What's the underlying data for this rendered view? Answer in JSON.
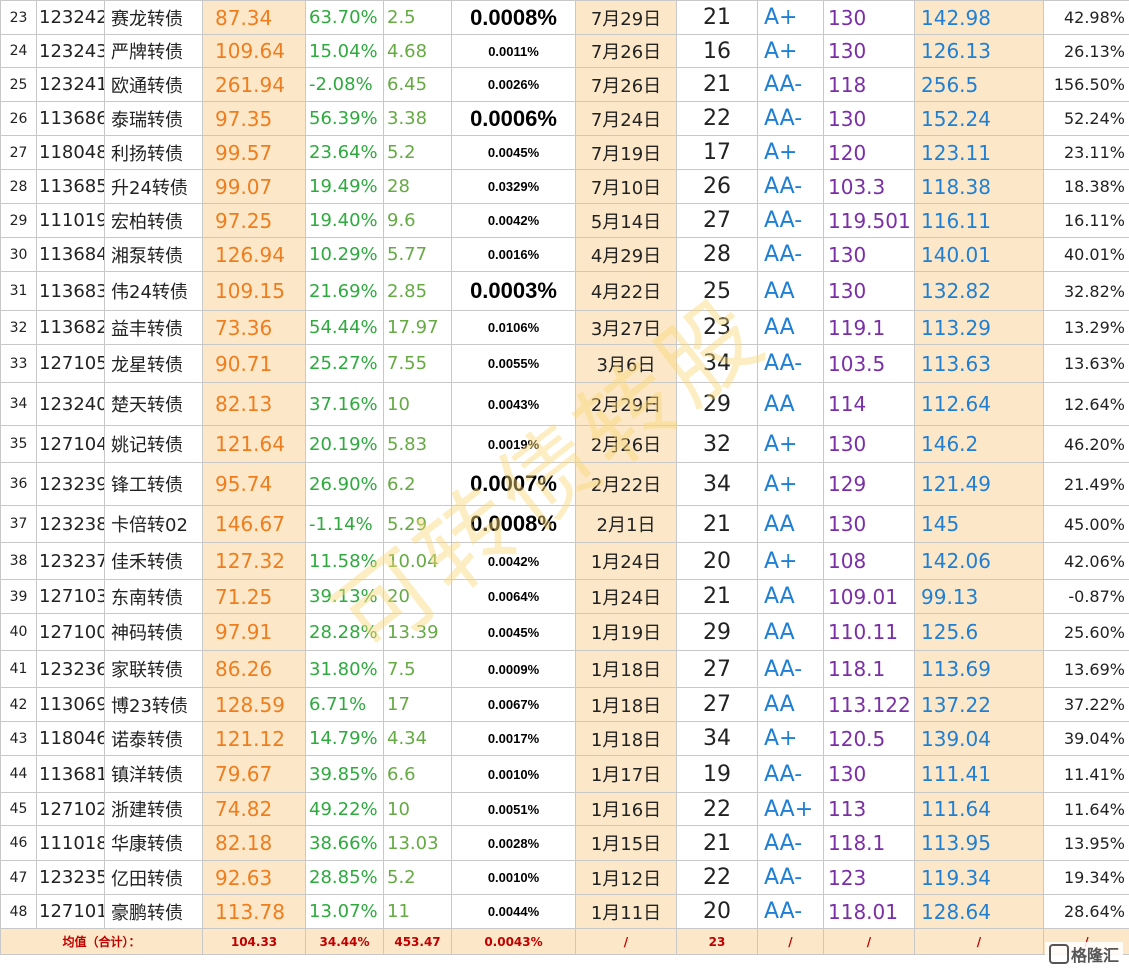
{
  "rows": [
    {
      "idx": "23",
      "code": "123242",
      "name": "赛龙转债",
      "price": "87.34",
      "pct": "63.70%",
      "ratio": "2.5",
      "rate": "0.0008%",
      "rate_big": true,
      "date": "7月29日",
      "num": "21",
      "grade": "A+",
      "first": "130",
      "last": "142.98",
      "gain": "42.98%"
    },
    {
      "idx": "24",
      "code": "123243",
      "name": "严牌转债",
      "price": "109.64",
      "pct": "15.04%",
      "ratio": "4.68",
      "rate": "0.0011%",
      "rate_big": false,
      "date": "7月26日",
      "num": "16",
      "grade": "A+",
      "first": "130",
      "last": "126.13",
      "gain": "26.13%"
    },
    {
      "idx": "25",
      "code": "123241",
      "name": "欧通转债",
      "price": "261.94",
      "pct": "-2.08%",
      "ratio": "6.45",
      "rate": "0.0026%",
      "rate_big": false,
      "date": "7月26日",
      "num": "21",
      "grade": "AA-",
      "first": "118",
      "last": "256.5",
      "gain": "156.50%"
    },
    {
      "idx": "26",
      "code": "113686",
      "name": "泰瑞转债",
      "price": "97.35",
      "pct": "56.39%",
      "ratio": "3.38",
      "rate": "0.0006%",
      "rate_big": true,
      "date": "7月24日",
      "num": "22",
      "grade": "AA-",
      "first": "130",
      "last": "152.24",
      "gain": "52.24%"
    },
    {
      "idx": "27",
      "code": "118048",
      "name": "利扬转债",
      "price": "99.57",
      "pct": "23.64%",
      "ratio": "5.2",
      "rate": "0.0045%",
      "rate_big": false,
      "date": "7月19日",
      "num": "17",
      "grade": "A+",
      "first": "120",
      "last": "123.11",
      "gain": "23.11%"
    },
    {
      "idx": "28",
      "code": "113685",
      "name": "升24转债",
      "price": "99.07",
      "pct": "19.49%",
      "ratio": "28",
      "rate": "0.0329%",
      "rate_big": false,
      "date": "7月10日",
      "num": "26",
      "grade": "AA-",
      "first": "103.3",
      "last": "118.38",
      "gain": "18.38%"
    },
    {
      "idx": "29",
      "code": "111019",
      "name": "宏柏转债",
      "price": "97.25",
      "pct": "19.40%",
      "ratio": "9.6",
      "rate": "0.0042%",
      "rate_big": false,
      "date": "5月14日",
      "num": "27",
      "grade": "AA-",
      "first": "119.501",
      "last": "116.11",
      "gain": "16.11%"
    },
    {
      "idx": "30",
      "code": "113684",
      "name": "湘泵转债",
      "price": "126.94",
      "pct": "10.29%",
      "ratio": "5.77",
      "rate": "0.0016%",
      "rate_big": false,
      "date": "4月29日",
      "num": "28",
      "grade": "AA-",
      "first": "130",
      "last": "140.01",
      "gain": "40.01%"
    },
    {
      "idx": "31",
      "code": "113683",
      "name": "伟24转债",
      "price": "109.15",
      "pct": "21.69%",
      "ratio": "2.85",
      "rate": "0.0003%",
      "rate_big": true,
      "date": "4月22日",
      "num": "25",
      "grade": "AA",
      "first": "130",
      "last": "132.82",
      "gain": "32.82%"
    },
    {
      "idx": "32",
      "code": "113682",
      "name": "益丰转债",
      "price": "73.36",
      "pct": "54.44%",
      "ratio": "17.97",
      "rate": "0.0106%",
      "rate_big": false,
      "date": "3月27日",
      "num": "23",
      "grade": "AA",
      "first": "119.1",
      "last": "113.29",
      "gain": "13.29%"
    },
    {
      "idx": "33",
      "code": "127105",
      "name": "龙星转债",
      "price": "90.71",
      "pct": "25.27%",
      "ratio": "7.55",
      "rate": "0.0055%",
      "rate_big": false,
      "date": "3月6日",
      "num": "34",
      "grade": "AA-",
      "first": "103.5",
      "last": "113.63",
      "gain": "13.63%"
    },
    {
      "idx": "34",
      "code": "123240",
      "name": "楚天转债",
      "price": "82.13",
      "pct": "37.16%",
      "ratio": "10",
      "rate": "0.0043%",
      "rate_big": false,
      "date": "2月29日",
      "num": "29",
      "grade": "AA",
      "first": "114",
      "last": "112.64",
      "gain": "12.64%"
    },
    {
      "idx": "35",
      "code": "127104",
      "name": "姚记转债",
      "price": "121.64",
      "pct": "20.19%",
      "ratio": "5.83",
      "rate": "0.0019%",
      "rate_big": false,
      "date": "2月26日",
      "num": "32",
      "grade": "A+",
      "first": "130",
      "last": "146.2",
      "gain": "46.20%"
    },
    {
      "idx": "36",
      "code": "123239",
      "name": "锋工转债",
      "price": "95.74",
      "pct": "26.90%",
      "ratio": "6.2",
      "rate": "0.0007%",
      "rate_big": true,
      "date": "2月22日",
      "num": "34",
      "grade": "A+",
      "first": "129",
      "last": "121.49",
      "gain": "21.49%"
    },
    {
      "idx": "37",
      "code": "123238",
      "name": "卡倍转02",
      "price": "146.67",
      "pct": "-1.14%",
      "ratio": "5.29",
      "rate": "0.0008%",
      "rate_big": true,
      "date": "2月1日",
      "num": "21",
      "grade": "AA",
      "first": "130",
      "last": "145",
      "gain": "45.00%"
    },
    {
      "idx": "38",
      "code": "123237",
      "name": "佳禾转债",
      "price": "127.32",
      "pct": "11.58%",
      "ratio": "10.04",
      "rate": "0.0042%",
      "rate_big": false,
      "date": "1月24日",
      "num": "20",
      "grade": "A+",
      "first": "108",
      "last": "142.06",
      "gain": "42.06%"
    },
    {
      "idx": "39",
      "code": "127103",
      "name": "东南转债",
      "price": "71.25",
      "pct": "39.13%",
      "ratio": "20",
      "rate": "0.0064%",
      "rate_big": false,
      "date": "1月24日",
      "num": "21",
      "grade": "AA",
      "first": "109.01",
      "last": "99.13",
      "gain": "-0.87%"
    },
    {
      "idx": "40",
      "code": "127100",
      "name": "神码转债",
      "price": "97.91",
      "pct": "28.28%",
      "ratio": "13.39",
      "rate": "0.0045%",
      "rate_big": false,
      "date": "1月19日",
      "num": "29",
      "grade": "AA",
      "first": "110.11",
      "last": "125.6",
      "gain": "25.60%"
    },
    {
      "idx": "41",
      "code": "123236",
      "name": "家联转债",
      "price": "86.26",
      "pct": "31.80%",
      "ratio": "7.5",
      "rate": "0.0009%",
      "rate_big": false,
      "date": "1月18日",
      "num": "27",
      "grade": "AA-",
      "first": "118.1",
      "last": "113.69",
      "gain": "13.69%"
    },
    {
      "idx": "42",
      "code": "113069",
      "name": "博23转债",
      "price": "128.59",
      "pct": "6.71%",
      "ratio": "17",
      "rate": "0.0067%",
      "rate_big": false,
      "date": "1月18日",
      "num": "27",
      "grade": "AA",
      "first": "113.122",
      "last": "137.22",
      "gain": "37.22%"
    },
    {
      "idx": "43",
      "code": "118046",
      "name": "诺泰转债",
      "price": "121.12",
      "pct": "14.79%",
      "ratio": "4.34",
      "rate": "0.0017%",
      "rate_big": false,
      "date": "1月18日",
      "num": "34",
      "grade": "A+",
      "first": "120.5",
      "last": "139.04",
      "gain": "39.04%"
    },
    {
      "idx": "44",
      "code": "113681",
      "name": "镇洋转债",
      "price": "79.67",
      "pct": "39.85%",
      "ratio": "6.6",
      "rate": "0.0010%",
      "rate_big": false,
      "date": "1月17日",
      "num": "19",
      "grade": "AA-",
      "first": "130",
      "last": "111.41",
      "gain": "11.41%"
    },
    {
      "idx": "45",
      "code": "127102",
      "name": "浙建转债",
      "price": "74.82",
      "pct": "49.22%",
      "ratio": "10",
      "rate": "0.0051%",
      "rate_big": false,
      "date": "1月16日",
      "num": "22",
      "grade": "AA+",
      "first": "113",
      "last": "111.64",
      "gain": "11.64%"
    },
    {
      "idx": "46",
      "code": "111018",
      "name": "华康转债",
      "price": "82.18",
      "pct": "38.66%",
      "ratio": "13.03",
      "rate": "0.0028%",
      "rate_big": false,
      "date": "1月15日",
      "num": "21",
      "grade": "AA-",
      "first": "118.1",
      "last": "113.95",
      "gain": "13.95%"
    },
    {
      "idx": "47",
      "code": "123235",
      "name": "亿田转债",
      "price": "92.63",
      "pct": "28.85%",
      "ratio": "5.2",
      "rate": "0.0010%",
      "rate_big": false,
      "date": "1月12日",
      "num": "22",
      "grade": "AA-",
      "first": "123",
      "last": "119.34",
      "gain": "19.34%"
    },
    {
      "idx": "48",
      "code": "127101",
      "name": "豪鹏转债",
      "price": "113.78",
      "pct": "13.07%",
      "ratio": "11",
      "rate": "0.0044%",
      "rate_big": false,
      "date": "1月11日",
      "num": "20",
      "grade": "AA-",
      "first": "118.01",
      "last": "128.64",
      "gain": "28.64%"
    }
  ],
  "footer": {
    "label": "均值（合计）：",
    "price": "104.33",
    "pct": "34.44%",
    "ratio": "453.47",
    "rate": "0.0043%",
    "date": "/",
    "num": "23",
    "grade": "/",
    "first": "/",
    "last": "/",
    "gain": "/"
  },
  "watermark": "可转债转股",
  "logo": "格隆汇"
}
